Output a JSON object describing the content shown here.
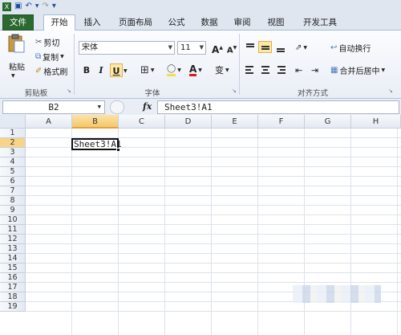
{
  "tabs": [
    "文件",
    "开始",
    "插入",
    "页面布局",
    "公式",
    "数据",
    "审阅",
    "视图",
    "开发工具"
  ],
  "clipboard": {
    "paste": "粘贴",
    "cut": "剪切",
    "copy": "复制",
    "format_painter": "格式刷",
    "group": "剪贴板"
  },
  "font": {
    "name": "宋体",
    "size": "11",
    "bold": "B",
    "italic": "I",
    "underline": "U",
    "grow": "A",
    "shrink": "A",
    "group": "字体",
    "phonetic": "变",
    "color_a": "A"
  },
  "alignment": {
    "wrap": "自动换行",
    "merge": "合并后居中",
    "group": "对齐方式"
  },
  "namebox": "B2",
  "fx": "fx",
  "formula": "Sheet3!A1",
  "columns": [
    "A",
    "B",
    "C",
    "D",
    "E",
    "F",
    "G",
    "H"
  ],
  "rows": [
    "1",
    "2",
    "3",
    "4",
    "5",
    "6",
    "7",
    "8",
    "9",
    "10",
    "11",
    "12",
    "13",
    "14",
    "15",
    "16",
    "17",
    "18",
    "19"
  ],
  "active_cell_text": "Sheet3!A1",
  "colors": {
    "file_tab": "#2a6a2f",
    "selection": "#f5c86a",
    "highlight_button": "#fde8a6",
    "font_color_bar": "#d22020",
    "fill_color_bar": "#f2e04b"
  }
}
